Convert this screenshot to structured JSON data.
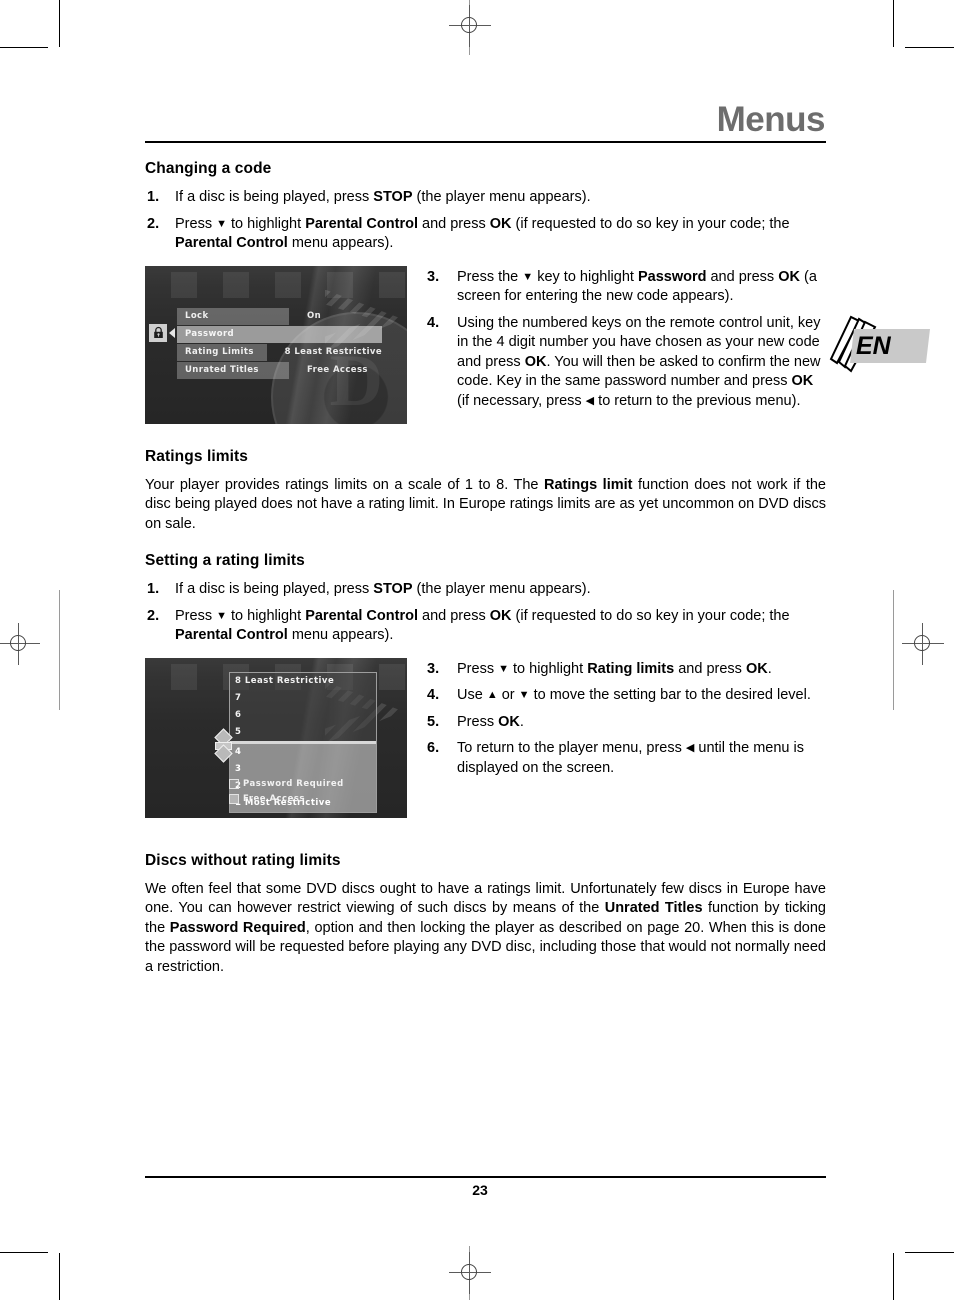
{
  "header": {
    "title": "Menus"
  },
  "language_tab": {
    "code": "EN"
  },
  "sections": {
    "changing_code": {
      "heading": "Changing a code",
      "step1_num": "1.",
      "step1_a": "If a disc is being played, press ",
      "step1_b": "STOP",
      "step1_c": " (the player menu appears).",
      "step2_num": "2.",
      "step2_a": "Press ",
      "step2_arrow": "▼",
      "step2_b": " to highlight ",
      "step2_c": "Parental Control",
      "step2_d": " and press ",
      "step2_e": "OK",
      "step2_f": " (if requested to do so key in your code; the ",
      "step2_g": "Parental Control",
      "step2_h": " menu appears).",
      "step3_num": "3.",
      "step3_a": "Press the ",
      "step3_arrow": "▼",
      "step3_b": " key to highlight ",
      "step3_c": "Password",
      "step3_d": " and press ",
      "step3_e": "OK",
      "step3_f": " (a screen for entering the new code appears).",
      "step4_num": "4.",
      "step4_a": "Using the numbered keys on the remote control unit, key in the 4 digit number you have chosen as your new code and press ",
      "step4_b": "OK",
      "step4_c": ". You will then be asked to confirm the new code. Key in the same password number and press ",
      "step4_d": "OK",
      "step4_e": " (if necessary, press ",
      "step4_arrow": "◀",
      "step4_f": " to return to the previous menu)."
    },
    "ratings_limits": {
      "heading": "Ratings limits",
      "para_a": "Your player provides ratings limits on a scale of 1 to 8. The ",
      "para_b": "Ratings limit",
      "para_c": " function does not work if the disc being played does not have a rating limit. In Europe ratings limits are as yet uncommon on DVD discs on sale."
    },
    "setting_rating": {
      "heading": "Setting a rating limits",
      "step1_num": "1.",
      "step1_a": "If a disc is being played, press ",
      "step1_b": "STOP",
      "step1_c": " (the player menu appears).",
      "step2_num": "2.",
      "step2_a": "Press ",
      "step2_arrow": "▼",
      "step2_b": " to highlight ",
      "step2_c": "Parental Control",
      "step2_d": " and press ",
      "step2_e": "OK",
      "step2_f": " (if requested to do so key in your code; the ",
      "step2_g": "Parental Control",
      "step2_h": " menu appears).",
      "step3_num": "3.",
      "step3_a": "Press ",
      "step3_arrow": "▼",
      "step3_b": " to highlight ",
      "step3_c": "Rating limits",
      "step3_d": " and press ",
      "step3_e": "OK",
      "step3_f": ".",
      "step4_num": "4.",
      "step4_a": "Use ",
      "step4_arrow_up": "▲",
      "step4_b": " or ",
      "step4_arrow_dn": "▼",
      "step4_c": " to move the setting bar to the desired level.",
      "step5_num": "5.",
      "step5_a": "Press ",
      "step5_b": "OK",
      "step5_c": ".",
      "step6_num": "6.",
      "step6_a": "To return to the player menu, press ",
      "step6_arrow": "◀",
      "step6_b": " until the menu is displayed on the screen."
    },
    "discs_without": {
      "heading": "Discs without rating limits",
      "para_a": "We often feel that some DVD discs ought to have a ratings limit. Unfortunately few discs in Europe have one. You can however restrict viewing of such discs by means of the ",
      "para_b": "Unrated Titles",
      "para_c": " function by ticking the ",
      "para_d": "Password Required",
      "para_e": ", option and then locking the player as described on page 20. When this is done the password will be requested before playing any DVD disc, including those that would not normally need a restriction."
    }
  },
  "figure_parental_control": {
    "lock_icon": "padlock-icon",
    "rows": [
      {
        "label": "Lock",
        "value": "On",
        "selected": false
      },
      {
        "label": "Password",
        "value": "",
        "selected": true
      },
      {
        "label": "Rating Limits",
        "value": "8 Least Restrictive",
        "selected": false
      },
      {
        "label": "Unrated Titles",
        "value": "Free Access",
        "selected": false
      }
    ]
  },
  "figure_rating_limits": {
    "levels_above": [
      "8 Least Restrictive",
      "7",
      "6",
      "5"
    ],
    "levels_below": [
      "4",
      "3",
      "2",
      "1 Most Restrictive"
    ],
    "checkboxes": [
      {
        "label": "Password Required",
        "checked": false
      },
      {
        "label": "Free Access",
        "checked": true
      }
    ]
  },
  "footer": {
    "page_number": "23"
  }
}
